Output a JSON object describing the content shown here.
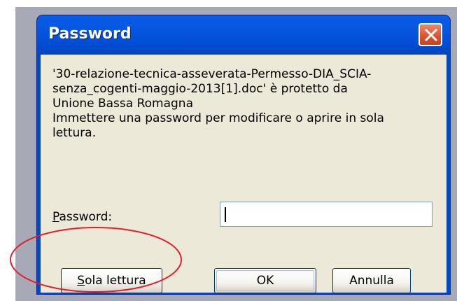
{
  "dialog": {
    "title": "Password",
    "message_lines": [
      "'30-relazione-tecnica-asseverata-Permesso-DIA_SCIA-",
      "senza_cogenti-maggio-2013[1].doc' è protetto da",
      "Unione Bassa Romagna",
      "Immettere una password per modificare o aprire in sola",
      "lettura."
    ],
    "password_label": "Password:",
    "password_value": "",
    "buttons": {
      "read_only": "Sola lettura",
      "ok": "OK",
      "cancel": "Annulla"
    }
  },
  "colors": {
    "titlebar": "#0049c4",
    "dialog_body": "#ece9d8",
    "close_button": "#d8522e",
    "highlight_ellipse": "#e0202a"
  },
  "icons": {
    "close": "close-icon"
  }
}
